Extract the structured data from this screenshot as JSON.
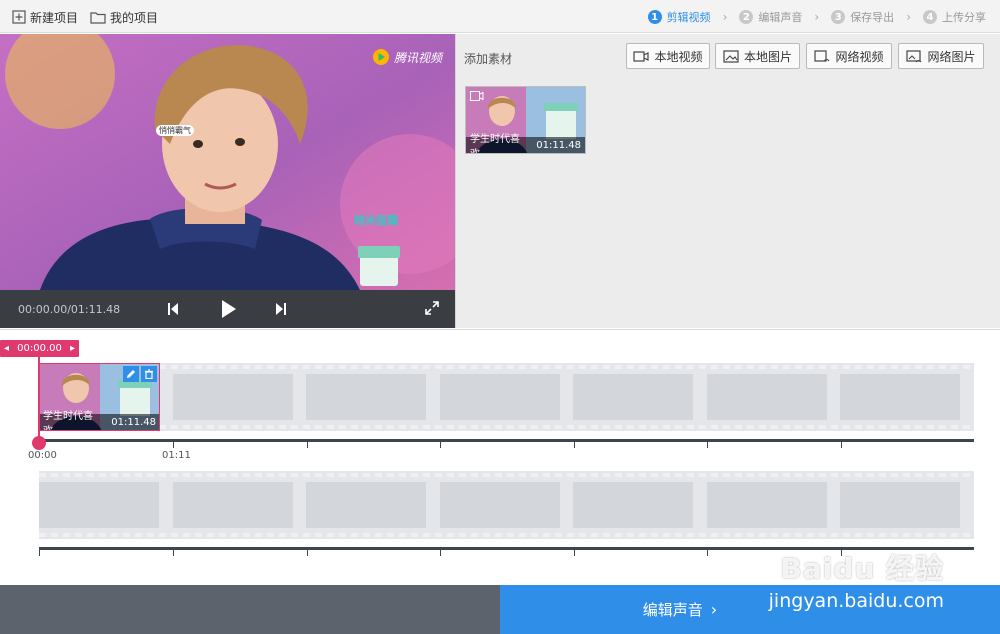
{
  "toolbar": {
    "new_project": "新建项目",
    "my_projects": "我的项目"
  },
  "steps": [
    {
      "num": "1",
      "label": "剪辑视频",
      "active": true
    },
    {
      "num": "2",
      "label": "编辑声音",
      "active": false
    },
    {
      "num": "3",
      "label": "保存导出",
      "active": false
    },
    {
      "num": "4",
      "label": "上传分享",
      "active": false
    }
  ],
  "preview": {
    "brand": "腾讯视频",
    "caption_tag": "悄悄霸气",
    "product_label": "晓米面霜",
    "timecode": "00:00.00/01:11.48"
  },
  "materials": {
    "title": "添加素材",
    "buttons": {
      "local_video": "本地视频",
      "local_image": "本地图片",
      "net_video": "网络视频",
      "net_image": "网络图片"
    },
    "items": [
      {
        "name": "学生时代喜欢...",
        "duration": "01:11.48"
      }
    ]
  },
  "timeline": {
    "playhead": "00:00.00",
    "clip": {
      "name": "学生时代喜欢...",
      "duration": "01:11.48"
    },
    "ruler_labels": [
      "00:00",
      "01:11"
    ]
  },
  "footer": {
    "next_label": "编辑声音"
  },
  "watermark": {
    "brand": "Baidu 经验",
    "url": "jingyan.baidu.com"
  },
  "colors": {
    "accent": "#2f8fe8",
    "playhead": "#e0396e",
    "dark_panel": "#3a3d42"
  }
}
